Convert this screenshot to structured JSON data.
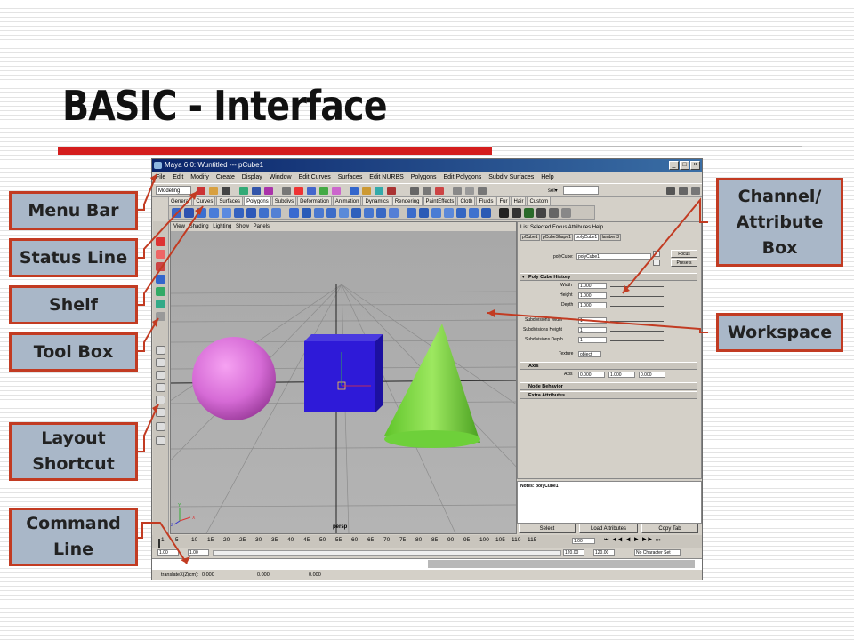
{
  "slide": {
    "title": "BASIC - Interface",
    "colors": {
      "accent_red": "#d41d1d",
      "callout_fill": "#a9b7c8",
      "callout_border": "#c23b22"
    }
  },
  "callouts": {
    "menu_bar": "Menu Bar",
    "status_line": "Status Line",
    "shelf": "Shelf",
    "tool_box": "Tool Box",
    "layout_shortcut_1": "Layout",
    "layout_shortcut_2": "Shortcut",
    "command_line_1": "Command",
    "command_line_2": "Line",
    "channel_box_1": "Channel/",
    "channel_box_2": "Attribute",
    "channel_box_3": "Box",
    "workspace": "Workspace"
  },
  "maya": {
    "title": "Maya 6.0: Wuntitled   ---   pCube1",
    "menu": [
      "File",
      "Edit",
      "Modify",
      "Create",
      "Display",
      "Window",
      "Edit Curves",
      "Surfaces",
      "Edit NURBS",
      "Polygons",
      "Edit Polygons",
      "Subdiv Surfaces",
      "Help"
    ],
    "mode": "Modeling",
    "sel_label": "sel▾",
    "shelf_tabs": [
      "General",
      "Curves",
      "Surfaces",
      "Polygons",
      "Subdivs",
      "Deformation",
      "Animation",
      "Dynamics",
      "Rendering",
      "PaintEffects",
      "Cloth",
      "Fluids",
      "Fur",
      "Hair",
      "Custom"
    ],
    "shelf_tab_selected": "Polygons",
    "viewport": {
      "menu": [
        "View",
        "Shading",
        "Lighting",
        "Show",
        "Panels"
      ],
      "camera_label": "persp",
      "axis_labels": [
        "Y",
        "Z",
        "X"
      ]
    },
    "attribute_editor": {
      "menu": [
        "List",
        "Selected",
        "Focus",
        "Attributes",
        "Help"
      ],
      "tabs": [
        "pCube1",
        "pCubeShape1",
        "polyCube1",
        "lambert3"
      ],
      "node_label": "polyCube:",
      "node_value": "polyCube1",
      "focus_btn": "Focus",
      "presets_btn": "Presets",
      "sections": {
        "history": "Poly Cube History",
        "axis": "Axis",
        "node_behavior": "Node Behavior",
        "extra": "Extra Attributes"
      },
      "width_label": "Width",
      "width_value": "1.000",
      "height_label": "Height",
      "height_value": "1.000",
      "depth_label": "Depth",
      "depth_value": "1.000",
      "subw_label": "Subdivisions Width",
      "subw_value": "1",
      "subh_label": "Subdivisions Height",
      "subh_value": "1",
      "subd_label": "Subdivisions Depth",
      "subd_value": "1",
      "texture_label": "Texture",
      "texture_value": "object",
      "axis_label": "Axis",
      "axis_x": "0.000",
      "axis_y": "1.000",
      "axis_z": "0.000",
      "notes_label": "Notes: polyCube1",
      "btn_select": "Select",
      "btn_load": "Load Attributes",
      "btn_copy": "Copy Tab"
    },
    "timeline": {
      "ticks": [
        "1",
        "5",
        "10",
        "15",
        "20",
        "25",
        "30",
        "35",
        "40",
        "45",
        "50",
        "55",
        "60",
        "65",
        "70",
        "75",
        "80",
        "85",
        "90",
        "95",
        "100",
        "105",
        "110",
        "115"
      ],
      "current_frame": "1.00"
    },
    "range": {
      "start": "1.00",
      "inner_start": "1.00",
      "end": "120.00",
      "inner_end": "120.00",
      "char_set": "No Character Set"
    },
    "help_line": {
      "label": "translateX(Z(cm):",
      "v1": "0.000",
      "v2": "0.000",
      "v3": "0.000"
    }
  }
}
